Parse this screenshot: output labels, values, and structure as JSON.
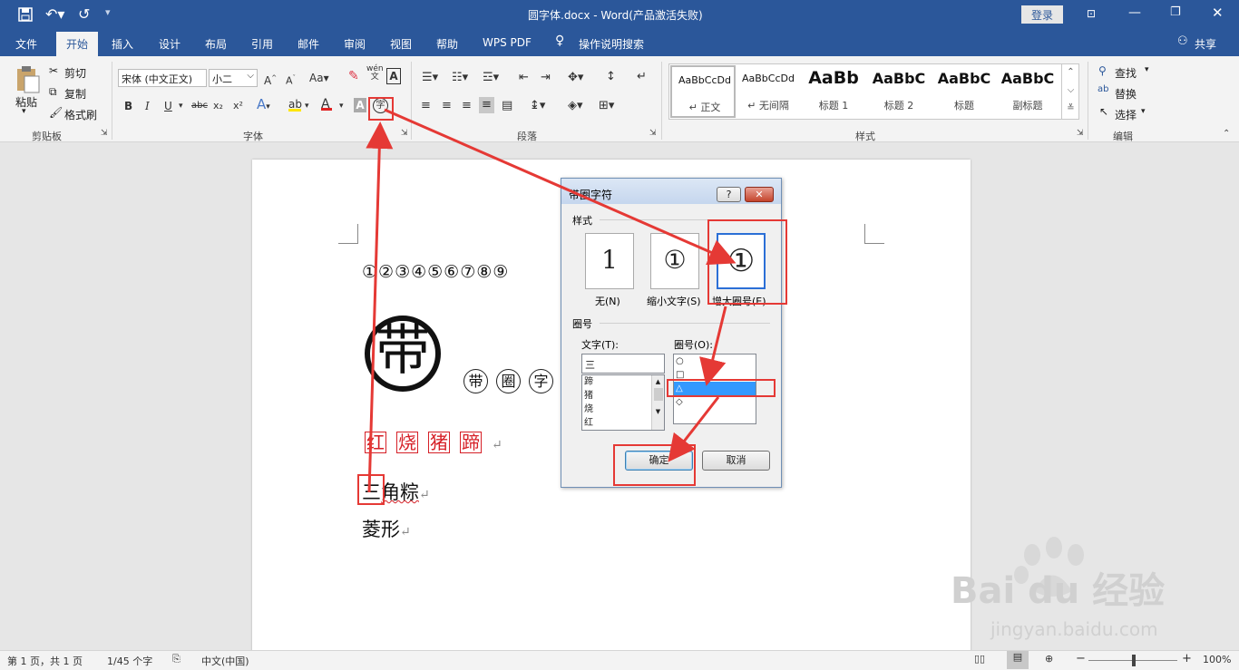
{
  "titlebar": {
    "title": "圆字体.docx - Word(产品激活失败)",
    "login": "登录",
    "quick_save_icon": "save-icon",
    "undo_icon": "undo-icon",
    "redo_icon": "redo-icon"
  },
  "tabs": [
    "文件",
    "开始",
    "插入",
    "设计",
    "布局",
    "引用",
    "邮件",
    "审阅",
    "视图",
    "帮助",
    "WPS PDF",
    "操作说明搜索"
  ],
  "share": "共享",
  "ribbon": {
    "clipboard": {
      "paste": "粘贴",
      "cut": "剪切",
      "copy": "复制",
      "format_painter": "格式刷",
      "group": "剪贴板"
    },
    "font": {
      "font_name": "宋体 (中文正文)",
      "font_size": "小二",
      "bold": "B",
      "italic": "I",
      "underline": "U",
      "strike": "abc",
      "sub": "x₂",
      "sup": "x²",
      "aa": "Aa",
      "wen": "wén",
      "enclose_char": "字",
      "group": "字体"
    },
    "paragraph": {
      "group": "段落"
    },
    "styles": {
      "group": "样式",
      "items": [
        {
          "preview": "AaBbCcDd",
          "name": "正文"
        },
        {
          "preview": "AaBbCcDd",
          "name": "无间隔"
        },
        {
          "preview": "AaBb",
          "name": "标题 1"
        },
        {
          "preview": "AaBbC",
          "name": "标题 2"
        },
        {
          "preview": "AaBbC",
          "name": "标题"
        },
        {
          "preview": "AaBbC",
          "name": "副标题"
        }
      ]
    },
    "editing": {
      "find": "查找",
      "replace": "替换",
      "select": "选择",
      "group": "编辑"
    }
  },
  "document": {
    "line1": "①②③④⑤⑥⑦⑧⑨",
    "big_char": "带",
    "circled": [
      "带",
      "圈",
      "字"
    ],
    "boxed": [
      "红",
      "烧",
      "猪",
      "蹄"
    ],
    "line3_first": "三",
    "line3_rest": "角粽",
    "line4": "菱形",
    "return_mark": "↵"
  },
  "dialog": {
    "title": "带圈字符",
    "help": "?",
    "close": "✕",
    "style_label": "样式",
    "style_options": [
      {
        "preview": "1",
        "label": "无(N)"
      },
      {
        "preview": "①",
        "label": "缩小文字(S)"
      },
      {
        "preview": "①",
        "label": "增大圈号(E)"
      }
    ],
    "circle_label": "圈号",
    "text_label": "文字(T):",
    "text_value": "三",
    "text_list": [
      "蹄",
      "猪",
      "烧",
      "红"
    ],
    "shape_label": "圈号(O):",
    "shape_list": [
      "○",
      "□",
      "△",
      "◇"
    ],
    "ok": "确定",
    "cancel": "取消"
  },
  "statusbar": {
    "page": "第 1 页，共 1 页",
    "words": "1/45 个字",
    "lang": "中文(中国)",
    "zoom": "100%"
  },
  "watermark": {
    "brand": "Bai du 经验",
    "url": "jingyan.baidu.com"
  }
}
